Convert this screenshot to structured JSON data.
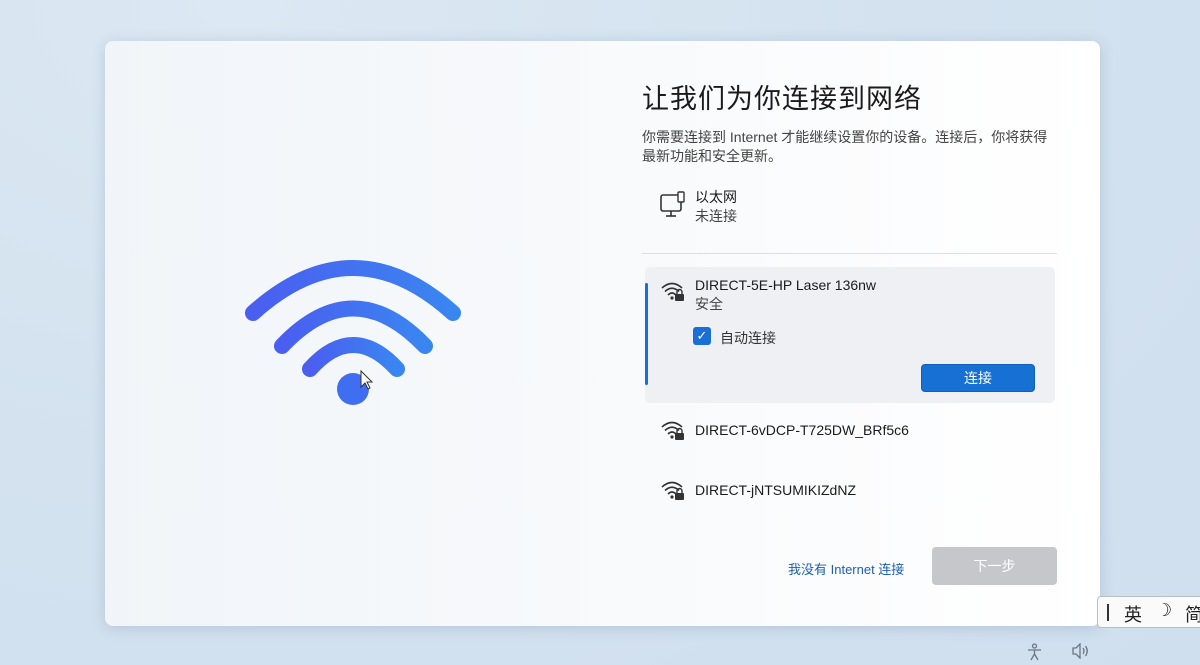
{
  "setup": {
    "title": "让我们为你连接到网络",
    "description": "你需要连接到 Internet 才能继续设置你的设备。连接后，你将获得最新功能和安全更新。",
    "hero_icon": "wifi-icon",
    "accent_color": "#1770d4"
  },
  "ethernet": {
    "icon": "ethernet-icon",
    "name": "以太网",
    "status": "未连接"
  },
  "networks": [
    {
      "name": "DIRECT-5E-HP Laser 136nw",
      "security": "安全",
      "selected": true,
      "auto_connect_label": "自动连接",
      "auto_connect_checked": true,
      "connect_label": "连接"
    },
    {
      "name": "DIRECT-6vDCP-T725DW_BRf5c6",
      "selected": false
    },
    {
      "name": "DIRECT-jNTSUMIKIZdNZ",
      "selected": false
    }
  ],
  "footer": {
    "no_internet_label": "我没有 Internet 连接",
    "next_label": "下一步"
  },
  "ime": {
    "lang": "英",
    "moon": "☽",
    "mode": "简"
  }
}
